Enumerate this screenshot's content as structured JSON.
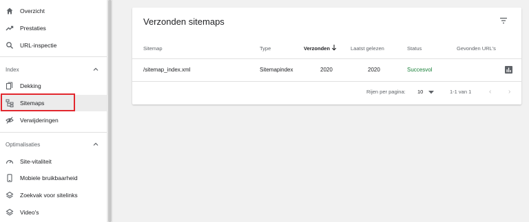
{
  "sidebar": {
    "items_top": [
      {
        "label": "Overzicht",
        "icon": "home-icon"
      },
      {
        "label": "Prestaties",
        "icon": "trending-up-icon"
      },
      {
        "label": "URL-inspectie",
        "icon": "search-icon"
      }
    ],
    "section_index": {
      "label": "Index"
    },
    "items_index": [
      {
        "label": "Dekking",
        "icon": "document-copy-icon"
      },
      {
        "label": "Sitemaps",
        "icon": "sitemap-icon"
      },
      {
        "label": "Verwijderingen",
        "icon": "eye-off-icon"
      }
    ],
    "section_opt": {
      "label": "Optimalisaties"
    },
    "items_opt": [
      {
        "label": "Site-vitaliteit",
        "icon": "speedometer-icon"
      },
      {
        "label": "Mobiele bruikbaarheid",
        "icon": "phone-icon"
      },
      {
        "label": "Zoekvak voor sitelinks",
        "icon": "layers-icon"
      },
      {
        "label": "Video's",
        "icon": "layers-icon"
      }
    ]
  },
  "card": {
    "title": "Verzonden sitemaps",
    "columns": {
      "sitemap": "Sitemap",
      "type": "Type",
      "submitted": "Verzonden",
      "last_read": "Laatst gelezen",
      "status": "Status",
      "found_urls": "Gevonden URL's"
    },
    "rows": [
      {
        "sitemap": "/sitemap_index.xml",
        "type": "Sitemapindex",
        "submitted": "2020",
        "last_read": "2020",
        "status": "Succesvol"
      }
    ],
    "pager": {
      "rows_label": "Rijen per pagina:",
      "rows_value": "10",
      "range": "1-1 van 1"
    }
  },
  "colors": {
    "highlight": "#e2262d",
    "success": "#188038"
  }
}
